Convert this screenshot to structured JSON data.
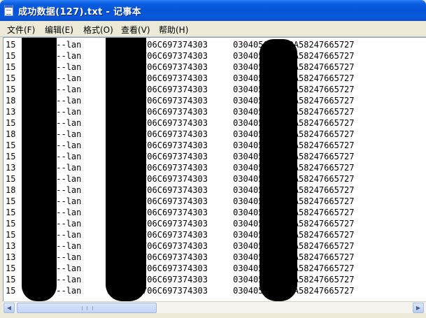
{
  "window": {
    "title": "成功数据(127).txt - 记事本"
  },
  "menu": [
    {
      "label": "文件(F)"
    },
    {
      "label": "编辑(E)"
    },
    {
      "label": "格式(O)"
    },
    {
      "label": "查看(V)"
    },
    {
      "label": "帮助(H)"
    }
  ],
  "editor": {
    "lines": [
      "15     13---lan     9----62706C697374303     030405060900A58247665727",
      "15     00---lan     9----62706C697374303     030405060900A58247665727",
      "15     45---lan     9----62706C697374303     030405060900A58247665727",
      "15     42---lan     9----62706C697374303     030405060900A58247665727",
      "15     74---lan     9----62706C697374303     030405060900A58247665727",
      "18     49---lan     9----62706C697374303     030405060900A58247665727",
      "13     64---lan     9----62706C697374303     030405060900A58247665727",
      "15     74---lan     9----62706C697374303     030405060900A58247665727",
      "18     48---lan     9----62706C697374303     030405060900A58247665727",
      "15     41---lan     9----62706C697374303     030405060900A58247665727",
      "15     83---lan     9----62706C697374303     030405060900A58247665727",
      "13     30---lan     9----62706C697374303     030405060900A58247665727",
      "15     92---lan     9----62706C697374303     030405060900A58247665727",
      "18     24---lan     9----62706C697374303     030405060900A58247665727",
      "15     64---lan     9----62706C697374303     030405060900A58247665727",
      "15     64---lan     9----62706C697374303     030405060900A58247665727",
      "15     47---lan     9----62706C697374303     030405060900A58247665727",
      "15     64---lan     9----62706C697374303     030405060900A58247665727",
      "13     15---lan     9----62706C697374303     030405060900A58247665727",
      "13     35---lan     9----62706C697374303     030405060900A58247665727",
      "15     14---lan     9----62706C697374303     030405060900A58247665727",
      "15     31---lan     9----62706C697374303     030405060900A58247665727",
      "15     14---lan     9----62706C697374303     030405060900A58247665727"
    ]
  },
  "colors": {
    "titlebar": "#0653d8",
    "chrome": "#ece9d8",
    "redaction": "#000000"
  },
  "icons": {
    "app": "notepad-icon",
    "scroll_left": "arrow-left-icon",
    "scroll_right": "arrow-right-icon"
  }
}
